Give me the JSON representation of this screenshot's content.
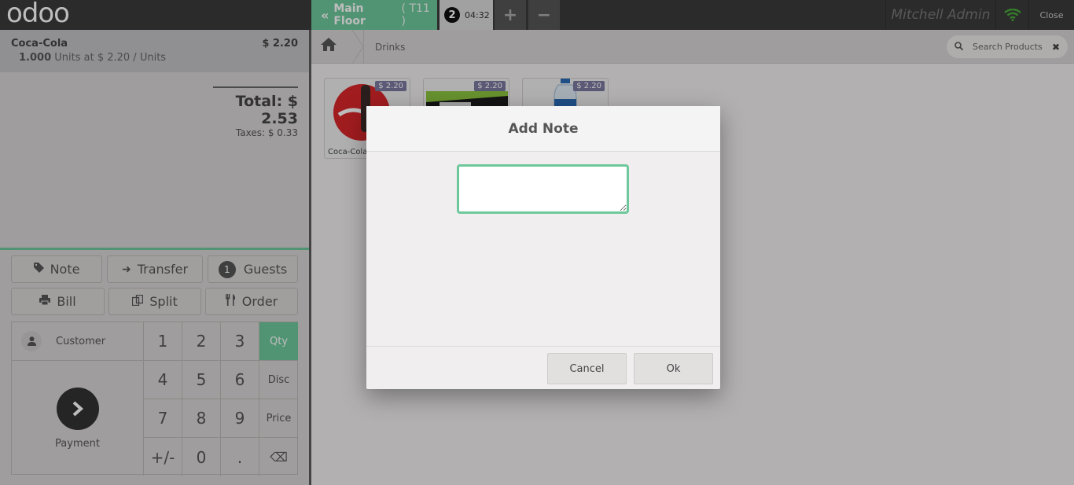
{
  "topbar": {
    "logo": "odoo",
    "floor_label": "Main Floor",
    "table_label": "( T11 )",
    "order_number": "2",
    "order_time": "04:32",
    "add_label": "+",
    "remove_label": "−",
    "user": "Mitchell Admin",
    "close_label": "Close"
  },
  "order": {
    "line_name": "Coca-Cola",
    "line_price": "$ 2.20",
    "line_qty": "1.000",
    "line_detail": "Units at $ 2.20 / Units",
    "total": "Total: $ 2.53",
    "taxes": "Taxes: $ 0.33"
  },
  "controls": {
    "note": "Note",
    "transfer": "Transfer",
    "guests_count": "1",
    "guests": "Guests",
    "bill": "Bill",
    "split": "Split",
    "order": "Order"
  },
  "numpad": {
    "customer": "Customer",
    "payment": "Payment",
    "keys": [
      "1",
      "2",
      "3",
      "4",
      "5",
      "6",
      "7",
      "8",
      "9",
      "+/-",
      "0",
      "."
    ],
    "qty": "Qty",
    "disc": "Disc",
    "price": "Price",
    "backspace": "⌫"
  },
  "products_bar": {
    "breadcrumb": "Drinks",
    "search_placeholder": "Search Products"
  },
  "products": [
    {
      "name": "Coca-Cola",
      "price": "$ 2.20"
    },
    {
      "name": "",
      "price": "$ 2.20"
    },
    {
      "name": "",
      "price": "$ 2.20"
    }
  ],
  "modal": {
    "title": "Add Note",
    "note_value": "",
    "cancel": "Cancel",
    "ok": "Ok"
  },
  "colors": {
    "accent": "#6ec89b",
    "topbar": "#3a3a3a"
  }
}
